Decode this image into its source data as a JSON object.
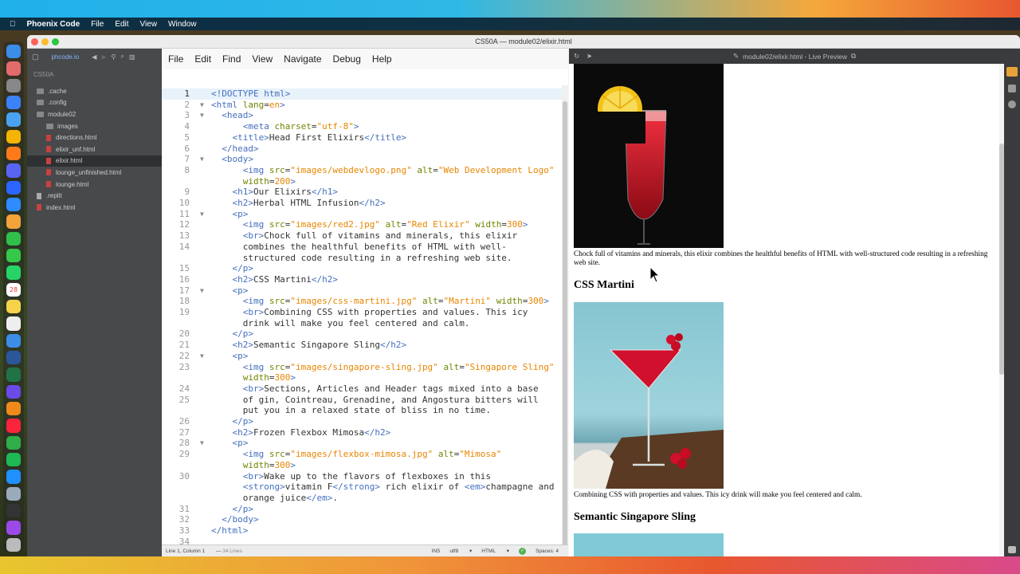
{
  "menubar": {
    "app_name": "Phoenix Code",
    "items": [
      "File",
      "Edit",
      "View",
      "Window"
    ]
  },
  "window": {
    "title": "CS50A — module02/elixir.html"
  },
  "sidebar": {
    "site": "phcode.io",
    "project": "CS50A",
    "tree": [
      {
        "label": ".cache",
        "type": "folder",
        "indent": 1
      },
      {
        "label": ".config",
        "type": "folder",
        "indent": 1
      },
      {
        "label": "module02",
        "type": "folder",
        "indent": 1
      },
      {
        "label": "images",
        "type": "folder",
        "indent": 2
      },
      {
        "label": "directions.html",
        "type": "file",
        "indent": 2
      },
      {
        "label": "elixir_unf.html",
        "type": "file",
        "indent": 2
      },
      {
        "label": "elixir.html",
        "type": "file",
        "indent": 2,
        "active": true
      },
      {
        "label": "lounge_unfinished.html",
        "type": "file",
        "indent": 2
      },
      {
        "label": "lounge.html",
        "type": "file",
        "indent": 2
      },
      {
        "label": ".replit",
        "type": "plain",
        "indent": 1
      },
      {
        "label": "index.html",
        "type": "file",
        "indent": 1
      }
    ]
  },
  "editor": {
    "menu": [
      "File",
      "Edit",
      "Find",
      "View",
      "Navigate",
      "Debug",
      "Help"
    ],
    "lines": [
      {
        "n": "1",
        "fold": "",
        "html": "<span class=\"tg\">&lt;!DOCTYPE html&gt;</span>",
        "cur": true
      },
      {
        "n": "2",
        "fold": "▼",
        "html": "<span class=\"tg\">&lt;html</span> <span class=\"at\">lang</span>=<span class=\"vl\">en</span><span class=\"tg\">&gt;</span>"
      },
      {
        "n": "3",
        "fold": "▼",
        "html": "  <span class=\"tg\">&lt;head&gt;</span>"
      },
      {
        "n": "4",
        "fold": "",
        "html": "      <span class=\"tg\">&lt;meta</span> <span class=\"at\">charset</span>=<span class=\"vl\">\"utf-8\"</span><span class=\"tg\">&gt;</span>"
      },
      {
        "n": "5",
        "fold": "",
        "html": "    <span class=\"tg\">&lt;title&gt;</span>Head First Elixirs<span class=\"tg\">&lt;/title&gt;</span>"
      },
      {
        "n": "6",
        "fold": "",
        "html": "  <span class=\"tg\">&lt;/head&gt;</span>"
      },
      {
        "n": "7",
        "fold": "▼",
        "html": "  <span class=\"tg\">&lt;body&gt;</span>"
      },
      {
        "n": "8",
        "fold": "",
        "html": "      <span class=\"tg\">&lt;img</span> <span class=\"at\">src</span>=<span class=\"vl\">\"images/webdevlogo.png\"</span> <span class=\"at\">alt</span>=<span class=\"vl\">\"Web Development Logo\"</span>"
      },
      {
        "n": "",
        "fold": "",
        "html": "      <span class=\"at\">width</span>=<span class=\"vl\">200</span><span class=\"tg\">&gt;</span>"
      },
      {
        "n": "9",
        "fold": "",
        "html": "    <span class=\"tg\">&lt;h1&gt;</span>Our Elixirs<span class=\"tg\">&lt;/h1&gt;</span>"
      },
      {
        "n": "10",
        "fold": "",
        "html": "    <span class=\"tg\">&lt;h2&gt;</span>Herbal HTML Infusion<span class=\"tg\">&lt;/h2&gt;</span>"
      },
      {
        "n": "11",
        "fold": "▼",
        "html": "    <span class=\"tg\">&lt;p&gt;</span>"
      },
      {
        "n": "12",
        "fold": "",
        "html": "      <span class=\"tg\">&lt;img</span> <span class=\"at\">src</span>=<span class=\"vl\">\"images/red2.jpg\"</span> <span class=\"at\">alt</span>=<span class=\"vl\">\"Red Elixir\"</span> <span class=\"at\">width</span>=<span class=\"vl\">300</span><span class=\"tg\">&gt;</span>"
      },
      {
        "n": "13",
        "fold": "",
        "html": "      <span class=\"tg\">&lt;br&gt;</span>Chock full of vitamins and minerals, this elixir"
      },
      {
        "n": "14",
        "fold": "",
        "html": "      combines the healthful benefits of HTML with well-"
      },
      {
        "n": "",
        "fold": "",
        "html": "      structured code resulting in a refreshing web site."
      },
      {
        "n": "15",
        "fold": "",
        "html": "    <span class=\"tg\">&lt;/p&gt;</span>"
      },
      {
        "n": "16",
        "fold": "",
        "html": "    <span class=\"tg\">&lt;h2&gt;</span>CSS Martini<span class=\"tg\">&lt;/h2&gt;</span>"
      },
      {
        "n": "17",
        "fold": "▼",
        "html": "    <span class=\"tg\">&lt;p&gt;</span>"
      },
      {
        "n": "18",
        "fold": "",
        "html": "      <span class=\"tg\">&lt;img</span> <span class=\"at\">src</span>=<span class=\"vl\">\"images/css-martini.jpg\"</span> <span class=\"at\">alt</span>=<span class=\"vl\">\"Martini\"</span> <span class=\"at\">width</span>=<span class=\"vl\">300</span><span class=\"tg\">&gt;</span>"
      },
      {
        "n": "19",
        "fold": "",
        "html": "      <span class=\"tg\">&lt;br&gt;</span>Combining CSS with properties and values. This icy"
      },
      {
        "n": "",
        "fold": "",
        "html": "      drink will make you feel centered and calm."
      },
      {
        "n": "20",
        "fold": "",
        "html": "    <span class=\"tg\">&lt;/p&gt;</span>"
      },
      {
        "n": "21",
        "fold": "",
        "html": "    <span class=\"tg\">&lt;h2&gt;</span>Semantic Singapore Sling<span class=\"tg\">&lt;/h2&gt;</span>"
      },
      {
        "n": "22",
        "fold": "▼",
        "html": "    <span class=\"tg\">&lt;p&gt;</span>"
      },
      {
        "n": "23",
        "fold": "",
        "html": "      <span class=\"tg\">&lt;img</span> <span class=\"at\">src</span>=<span class=\"vl\">\"images/singapore-sling.jpg\"</span> <span class=\"at\">alt</span>=<span class=\"vl\">\"Singapore Sling\"</span>"
      },
      {
        "n": "",
        "fold": "",
        "html": "      <span class=\"at\">width</span>=<span class=\"vl\">300</span><span class=\"tg\">&gt;</span>"
      },
      {
        "n": "24",
        "fold": "",
        "html": "      <span class=\"tg\">&lt;br&gt;</span>Sections, Articles and Header tags mixed into a base"
      },
      {
        "n": "25",
        "fold": "",
        "html": "      of gin, Cointreau, Grenadine, and Angostura bitters will"
      },
      {
        "n": "",
        "fold": "",
        "html": "      put you in a relaxed state of bliss in no time."
      },
      {
        "n": "26",
        "fold": "",
        "html": "    <span class=\"tg\">&lt;/p&gt;</span>"
      },
      {
        "n": "27",
        "fold": "",
        "html": "    <span class=\"tg\">&lt;h2&gt;</span>Frozen Flexbox Mimosa<span class=\"tg\">&lt;/h2&gt;</span>"
      },
      {
        "n": "28",
        "fold": "▼",
        "html": "    <span class=\"tg\">&lt;p&gt;</span>"
      },
      {
        "n": "29",
        "fold": "",
        "html": "      <span class=\"tg\">&lt;img</span> <span class=\"at\">src</span>=<span class=\"vl\">\"images/flexbox-mimosa.jpg\"</span> <span class=\"at\">alt</span>=<span class=\"vl\">\"Mimosa\"</span>"
      },
      {
        "n": "",
        "fold": "",
        "html": "      <span class=\"at\">width</span>=<span class=\"vl\">300</span><span class=\"tg\">&gt;</span>"
      },
      {
        "n": "30",
        "fold": "",
        "html": "      <span class=\"tg\">&lt;br&gt;</span>Wake up to the flavors of flexboxes in this"
      },
      {
        "n": "",
        "fold": "",
        "html": "      <span class=\"tg\">&lt;strong&gt;</span>vitamin F<span class=\"tg\">&lt;/strong&gt;</span> rich elixir of <span class=\"tg\">&lt;em&gt;</span>champagne and"
      },
      {
        "n": "",
        "fold": "",
        "html": "      orange juice<span class=\"tg\">&lt;/em&gt;</span>."
      },
      {
        "n": "31",
        "fold": "",
        "html": "    <span class=\"tg\">&lt;/p&gt;</span>"
      },
      {
        "n": "32",
        "fold": "",
        "html": "  <span class=\"tg\">&lt;/body&gt;</span>"
      },
      {
        "n": "33",
        "fold": "",
        "html": "<span class=\"tg\">&lt;/html&gt;</span>"
      },
      {
        "n": "34",
        "fold": "",
        "html": ""
      }
    ],
    "status": {
      "position": "Line 1, Column 1",
      "lines": "34 Lines",
      "mode": "INS",
      "encoding": "utf8",
      "language": "HTML",
      "spaces": "Spaces: 4"
    }
  },
  "preview": {
    "title": "module02/elixir.html - Live Preview",
    "para1": "Chock full of vitamins and minerals, this elixir combines the healthful benefits of HTML with well-structured code resulting in a refreshing web site.",
    "h2_martini": "CSS Martini",
    "para2": "Combining CSS with properties and values. This icy drink will make you feel centered and calm.",
    "h2_sling": "Semantic Singapore Sling"
  },
  "dock_icons": [
    "finder-icon",
    "launchpad-icon",
    "settings-icon",
    "mail-icon",
    "safari-icon",
    "chrome-icon",
    "firefox-icon",
    "discord-icon",
    "arc-icon",
    "zoom-icon",
    "photos-icon",
    "facetime-icon",
    "messages-icon",
    "whatsapp-icon",
    "calendar-icon",
    "notes-icon",
    "reminders-icon",
    "finder2-icon",
    "word-icon",
    "excel-icon",
    "music2-icon",
    "pages-icon",
    "music-icon",
    "numbers-icon",
    "spotify-icon",
    "appstore-icon",
    "preview-icon",
    "monitor-icon",
    "podcasts-icon",
    "trash-icon"
  ],
  "colors": {
    "accent": "#446fbd",
    "attr": "#6d8600",
    "value": "#e88501"
  }
}
